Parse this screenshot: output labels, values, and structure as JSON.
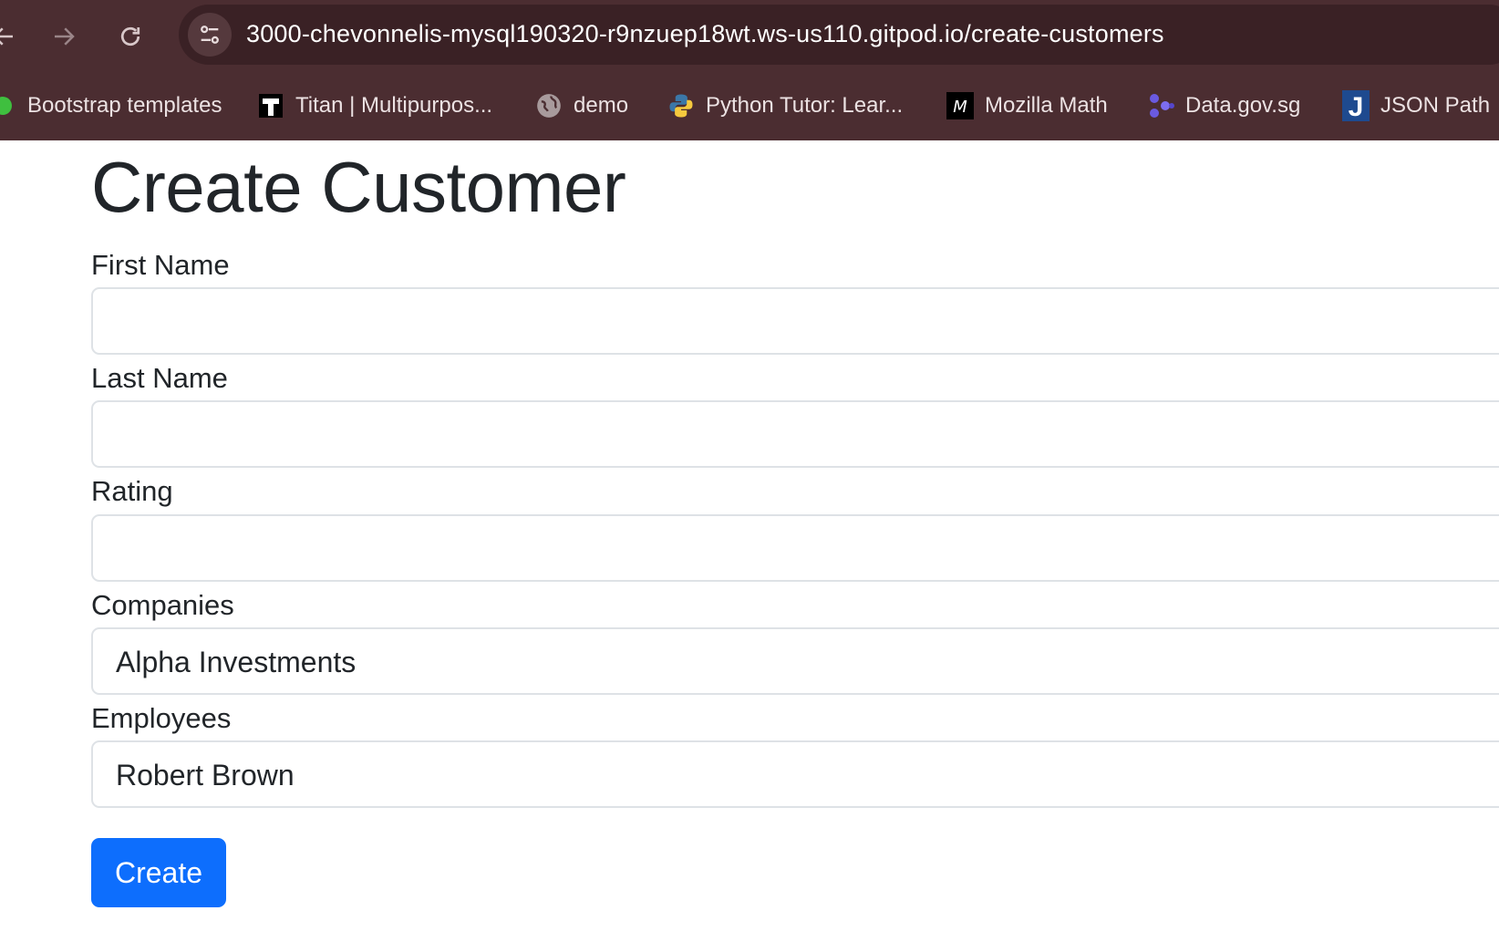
{
  "browser": {
    "url": "3000-chevonnelis-mysql190320-r9nzuep18wt.ws-us110.gitpod.io/create-customers",
    "bookmarks": [
      {
        "label": "Bootstrap templates",
        "icon": "green-circle-icon"
      },
      {
        "label": "Titan | Multipurpos...",
        "icon": "titan-t-icon"
      },
      {
        "label": "demo",
        "icon": "globe-icon"
      },
      {
        "label": "Python Tutor: Lear...",
        "icon": "python-icon"
      },
      {
        "label": "Mozilla Math",
        "icon": "mozilla-m-icon"
      },
      {
        "label": "Data.gov.sg",
        "icon": "data-gov-icon"
      },
      {
        "label": "JSON Path",
        "icon": "json-j-icon"
      }
    ]
  },
  "page": {
    "title": "Create Customer",
    "fields": [
      {
        "label": "First Name",
        "value": ""
      },
      {
        "label": "Last Name",
        "value": ""
      },
      {
        "label": "Rating",
        "value": ""
      },
      {
        "label": "Companies",
        "value": "Alpha Investments"
      },
      {
        "label": "Employees",
        "value": "Robert Brown"
      }
    ],
    "submit_label": "Create"
  },
  "colors": {
    "chrome_bg": "#4b2d31",
    "primary_button": "#0d6efd"
  }
}
